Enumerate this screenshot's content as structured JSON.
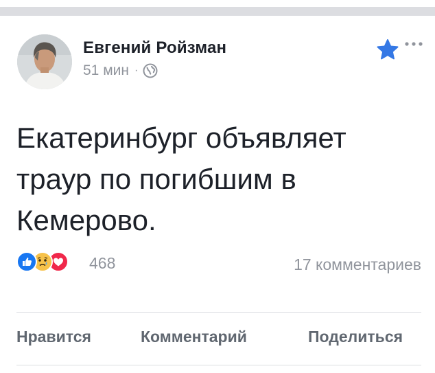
{
  "post": {
    "author": "Евгений Ройзман",
    "time": "51 мин",
    "separator": "·",
    "privacy_icon": "globe-icon",
    "text": "Екатеринбург объявляет траур по погибшим в Кемерово.",
    "favorite_icon": "star-icon",
    "favorite_color": "#3578e5",
    "more_icon": "ellipsis-icon"
  },
  "reactions": {
    "icons": [
      "like-icon",
      "sad-icon",
      "love-icon"
    ],
    "count": "468",
    "comments": "17 комментариев"
  },
  "actions": {
    "like": "Нравится",
    "comment": "Комментарий",
    "share": "Поделиться"
  }
}
